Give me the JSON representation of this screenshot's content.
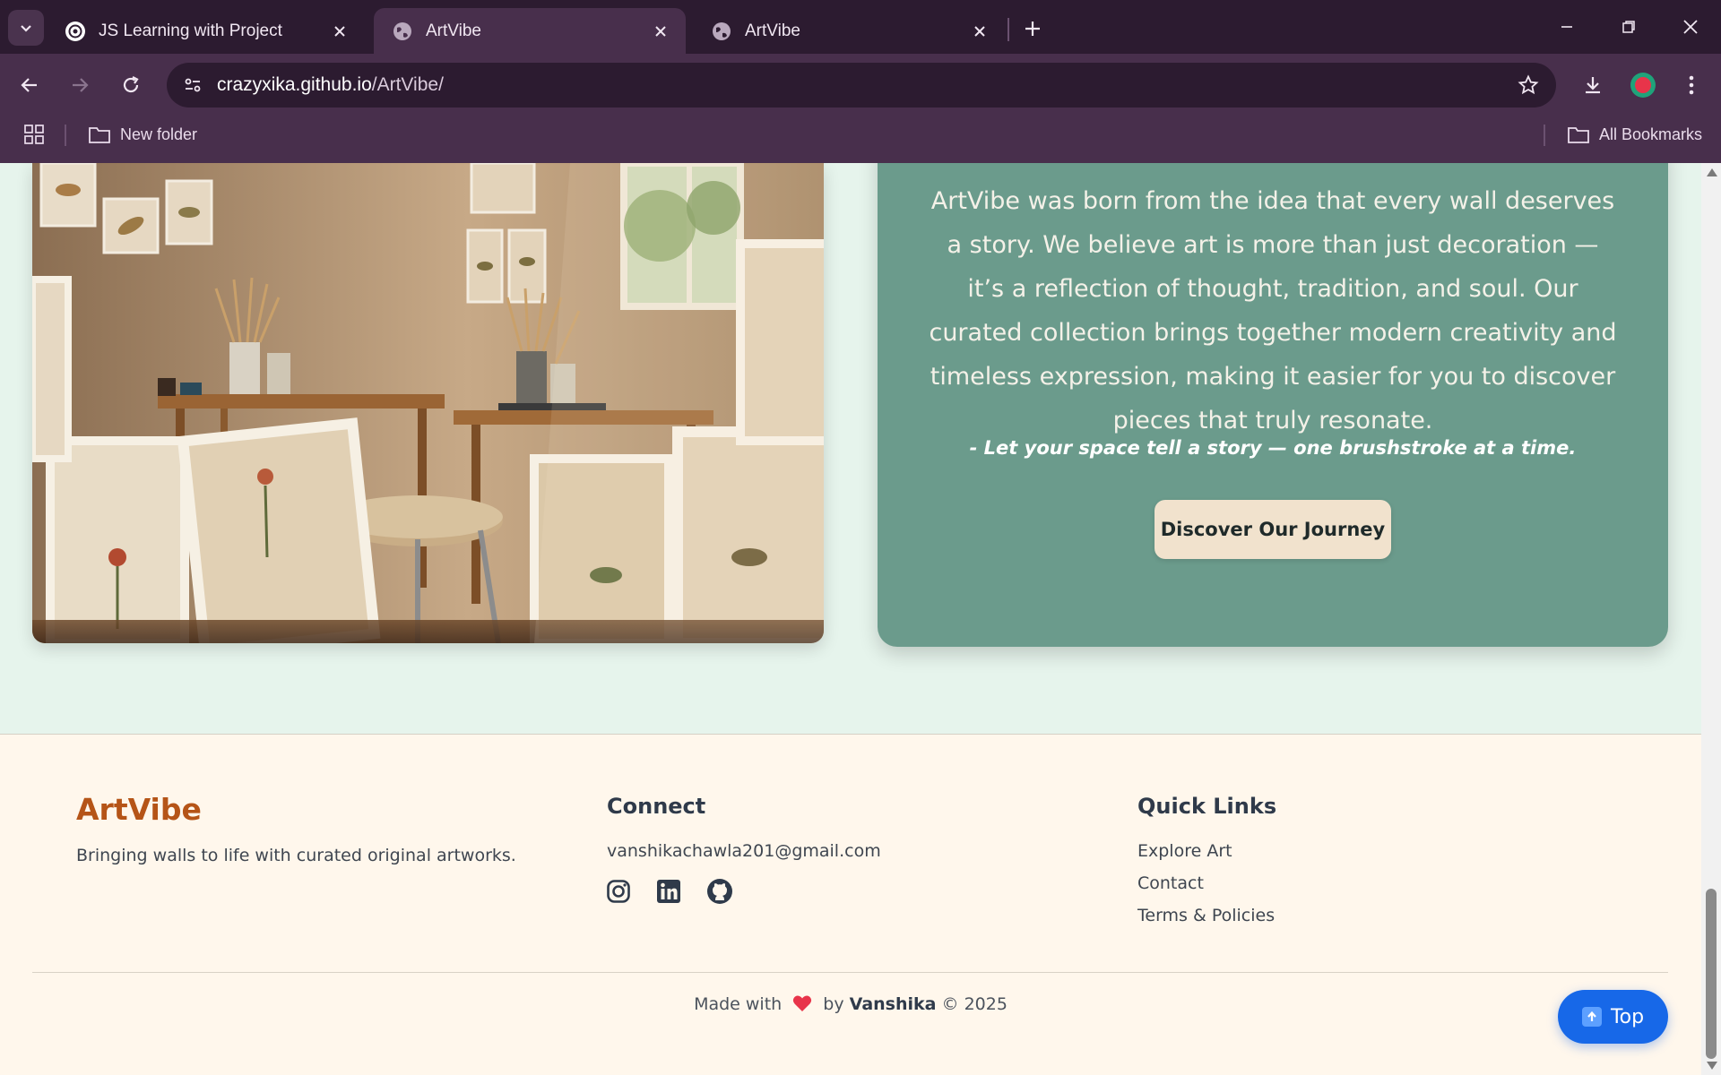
{
  "browser": {
    "tabs": [
      {
        "title": "JS Learning with Project",
        "active": false,
        "icon": "openai-icon"
      },
      {
        "title": "ArtVibe",
        "active": true,
        "icon": "globe-icon"
      },
      {
        "title": "ArtVibe",
        "active": false,
        "icon": "globe-icon"
      }
    ],
    "url_host": "crazyxika.github.io",
    "url_path": "/ArtVibe/",
    "bookmarks": {
      "folder": "New folder",
      "all": "All Bookmarks"
    }
  },
  "about": {
    "text": "ArtVibe was born from the idea that every wall deserves a story. We believe art is more than just decoration — it’s a reflection of thought, tradition, and soul. Our curated collection brings together modern creativity and timeless expression, making it easier for you to discover pieces that truly resonate.",
    "quote": "- Let your space tell a story — one brushstroke at a time.",
    "button": "Discover Our Journey"
  },
  "footer": {
    "brand": "ArtVibe",
    "tagline": "Bringing walls to life with curated original artworks.",
    "connect_title": "Connect",
    "email": "vanshikachawla201@gmail.com",
    "social": [
      "instagram-icon",
      "linkedin-icon",
      "github-icon"
    ],
    "quick_title": "Quick Links",
    "links": [
      "Explore Art",
      "Contact",
      "Terms & Policies"
    ],
    "made_with": "Made with",
    "by": "by",
    "author": "Vanshika",
    "copyright": "© 2025",
    "top_button": "Top"
  },
  "colors": {
    "chrome": "#482f4c",
    "page_bg": "#e6f4ec",
    "card": "#6b9b8c",
    "brand": "#b55417",
    "top_button": "#1768e8"
  }
}
